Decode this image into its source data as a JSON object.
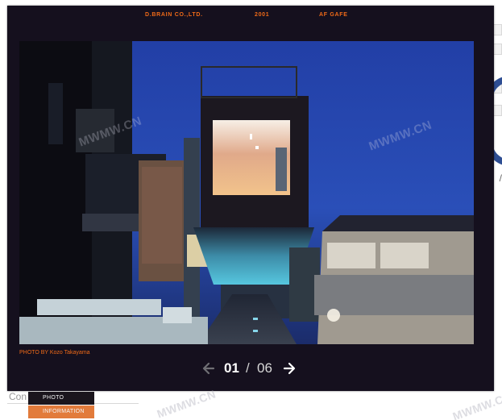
{
  "viewer": {
    "company": "D.BRAIN CO.,LTD.",
    "year": "2001",
    "project": "AF GAFE",
    "credit": "PHOTO BY Kozo Takayama",
    "current_page": "01",
    "separator": "/",
    "total_pages": "06",
    "prev_icon": "arrow-left-icon",
    "next_icon": "arrow-right-icon"
  },
  "background": {
    "partial_text": "Con",
    "side_text": "/"
  },
  "menu": {
    "items": [
      {
        "label": "PHOTO",
        "state": "default"
      },
      {
        "label": "INFORMATION",
        "state": "active"
      }
    ]
  },
  "watermarks": {
    "text": "MWMW.CN"
  },
  "colors": {
    "accent": "#f06a18",
    "menu_active": "#e27b3b",
    "viewer_bg": "#15101e",
    "sky": "#2b4fb3"
  }
}
